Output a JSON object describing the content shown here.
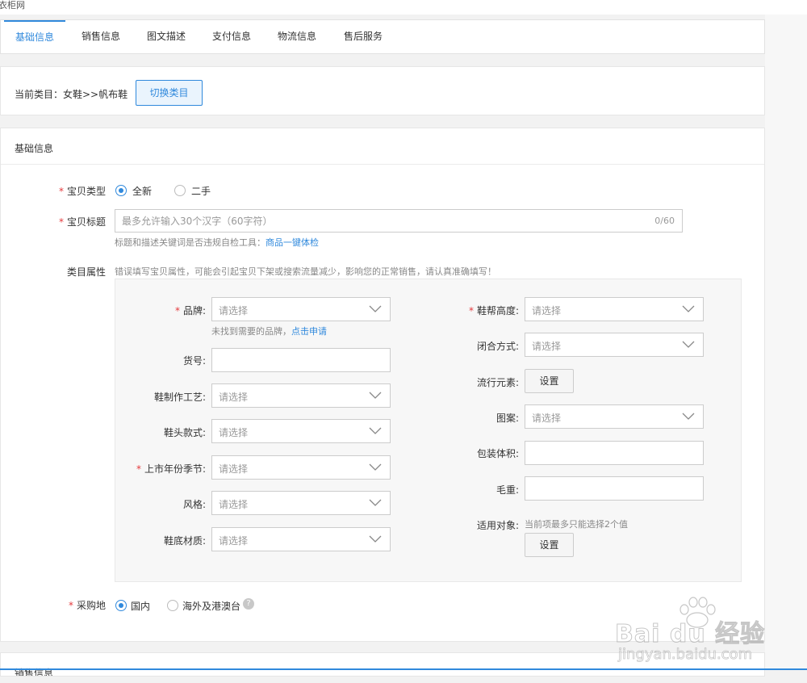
{
  "topbar": {
    "text": "衣柜网"
  },
  "tabs": [
    {
      "label": "基础信息",
      "active": true
    },
    {
      "label": "销售信息",
      "active": false
    },
    {
      "label": "图文描述",
      "active": false
    },
    {
      "label": "支付信息",
      "active": false
    },
    {
      "label": "物流信息",
      "active": false
    },
    {
      "label": "售后服务",
      "active": false
    }
  ],
  "category": {
    "label": "当前类目：女鞋>>帆布鞋",
    "switch_button": "切换类目"
  },
  "basic": {
    "section_title": "基础信息",
    "item_type": {
      "label": "宝贝类型",
      "options": [
        {
          "label": "全新",
          "selected": true
        },
        {
          "label": "二手",
          "selected": false
        }
      ]
    },
    "item_title": {
      "label": "宝贝标题",
      "placeholder": "最多允许输入30个汉字（60字符）",
      "counter": "0/60",
      "hint": "标题和描述关键词是否违规自检工具：",
      "hint_link": "商品一键体检"
    },
    "attributes": {
      "label": "类目属性",
      "warning": "错误填写宝贝属性，可能会引起宝贝下架或搜索流量减少，影响您的正常销售，请认真准确填写！",
      "left": {
        "brand": {
          "label": "品牌:",
          "placeholder": "请选择",
          "required": true
        },
        "brand_hint": "未找到需要的品牌，",
        "brand_link": "点击申请",
        "article_no": {
          "label": "货号:"
        },
        "craft": {
          "label": "鞋制作工艺:",
          "placeholder": "请选择"
        },
        "toe_style": {
          "label": "鞋头款式:",
          "placeholder": "请选择"
        },
        "season": {
          "label": "上市年份季节:",
          "placeholder": "请选择",
          "required": true
        },
        "style": {
          "label": "风格:",
          "placeholder": "请选择"
        },
        "sole_material": {
          "label": "鞋底材质:",
          "placeholder": "请选择"
        }
      },
      "right": {
        "heel_height": {
          "label": "鞋帮高度:",
          "placeholder": "请选择",
          "required": true
        },
        "closure": {
          "label": "闭合方式:",
          "placeholder": "请选择"
        },
        "trend": {
          "label": "流行元素:",
          "button": "设置"
        },
        "pattern": {
          "label": "图案:",
          "placeholder": "请选择"
        },
        "package_volume": {
          "label": "包装体积:"
        },
        "gross_weight": {
          "label": "毛重:"
        },
        "target": {
          "label": "适用对象:",
          "hint": "当前项最多只能选择2个值",
          "button": "设置"
        }
      }
    },
    "purchase_place": {
      "label": "采购地",
      "options": [
        {
          "label": "国内",
          "selected": true
        },
        {
          "label": "海外及港澳台",
          "selected": false
        }
      ],
      "help_icon": "question-icon"
    }
  },
  "next_section": {
    "title": "销售信息"
  },
  "watermark": {
    "brand": "Bai du 经验",
    "url": "jingyan.baidu.com"
  },
  "colors": {
    "accent": "#3089dc",
    "required": "#e4393c"
  }
}
